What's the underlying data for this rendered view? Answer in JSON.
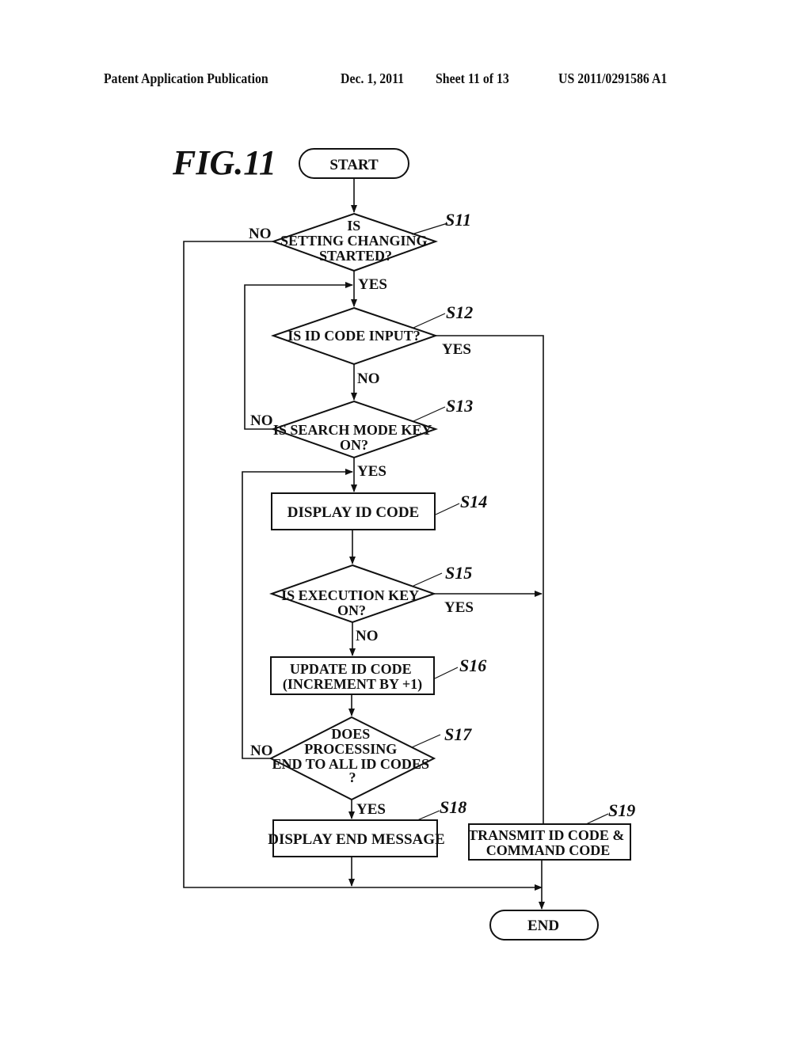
{
  "header": {
    "publication": "Patent Application Publication",
    "date": "Dec. 1, 2011",
    "sheet": "Sheet 11 of 13",
    "number": "US 2011/0291586 A1"
  },
  "figure": {
    "label": "FIG.11",
    "start": "START",
    "end": "END",
    "steps": {
      "s11": {
        "id": "S11",
        "lines": [
          "IS",
          "SETTING CHANGING",
          "STARTED?"
        ]
      },
      "s12": {
        "id": "S12",
        "lines": [
          "IS ID CODE INPUT?"
        ]
      },
      "s13": {
        "id": "S13",
        "lines": [
          "IS SEARCH MODE KEY",
          "ON?"
        ]
      },
      "s14": {
        "id": "S14",
        "lines": [
          "DISPLAY ID CODE"
        ]
      },
      "s15": {
        "id": "S15",
        "lines": [
          "IS EXECUTION KEY",
          "ON?"
        ]
      },
      "s16": {
        "id": "S16",
        "lines": [
          "UPDATE ID CODE",
          "(INCREMENT BY +1)"
        ]
      },
      "s17": {
        "id": "S17",
        "lines": [
          "DOES",
          "PROCESSING",
          "END TO ALL ID CODES",
          "?"
        ]
      },
      "s18": {
        "id": "S18",
        "lines": [
          "DISPLAY END MESSAGE"
        ]
      },
      "s19": {
        "id": "S19",
        "lines": [
          "TRANSMIT ID CODE &",
          "COMMAND CODE"
        ]
      }
    },
    "branches": {
      "s11_no": "NO",
      "s11_yes": "YES",
      "s12_yes": "YES",
      "s12_no": "NO",
      "s13_no": "NO",
      "s13_yes": "YES",
      "s15_yes": "YES",
      "s15_no": "NO",
      "s17_no": "NO",
      "s17_yes": "YES"
    }
  }
}
